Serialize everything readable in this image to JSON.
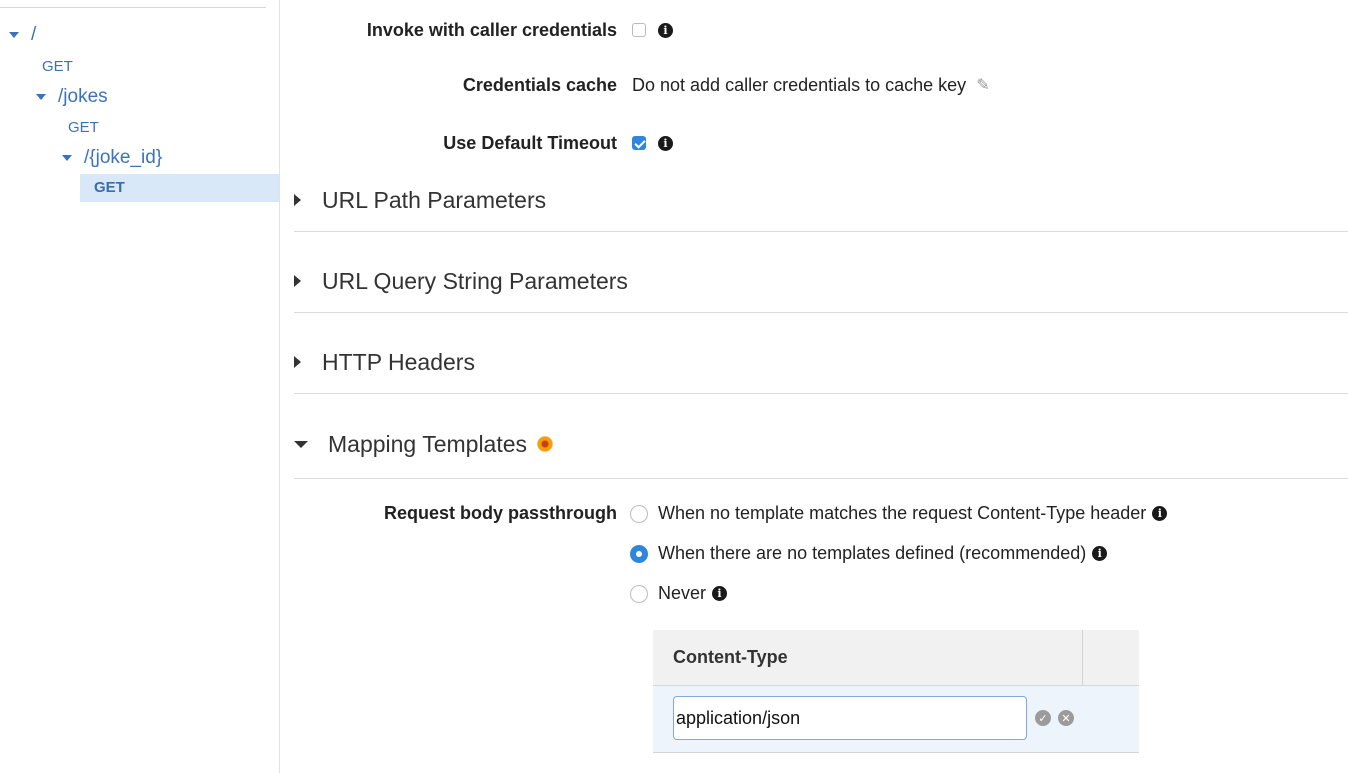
{
  "sidebar": {
    "root": {
      "path": "/",
      "method": "GET"
    },
    "jokes": {
      "path": "/jokes",
      "method": "GET"
    },
    "joke_id": {
      "path": "/{joke_id}",
      "method": "GET"
    }
  },
  "settings": {
    "invoke_label": "Invoke with caller credentials",
    "invoke_checked": false,
    "cache_label": "Credentials cache",
    "cache_value": "Do not add caller credentials to cache key",
    "timeout_label": "Use Default Timeout",
    "timeout_checked": true
  },
  "sections": {
    "url_path": "URL Path Parameters",
    "url_query": "URL Query String Parameters",
    "http_headers": "HTTP Headers",
    "mapping": "Mapping Templates"
  },
  "passthrough": {
    "label": "Request body passthrough",
    "options": [
      "When no template matches the request Content-Type header",
      "When there are no templates defined (recommended)",
      "Never"
    ],
    "selected_index": 1
  },
  "content_type": {
    "header": "Content-Type",
    "value": "application/json"
  },
  "colors": {
    "link": "#3b73b9",
    "accent": "#2e86de",
    "selected_bg": "#d9e8f8"
  },
  "icons": [
    "info-icon",
    "pencil-icon",
    "check-circle-icon",
    "cancel-circle-icon",
    "caret-down-icon",
    "caret-right-icon"
  ]
}
